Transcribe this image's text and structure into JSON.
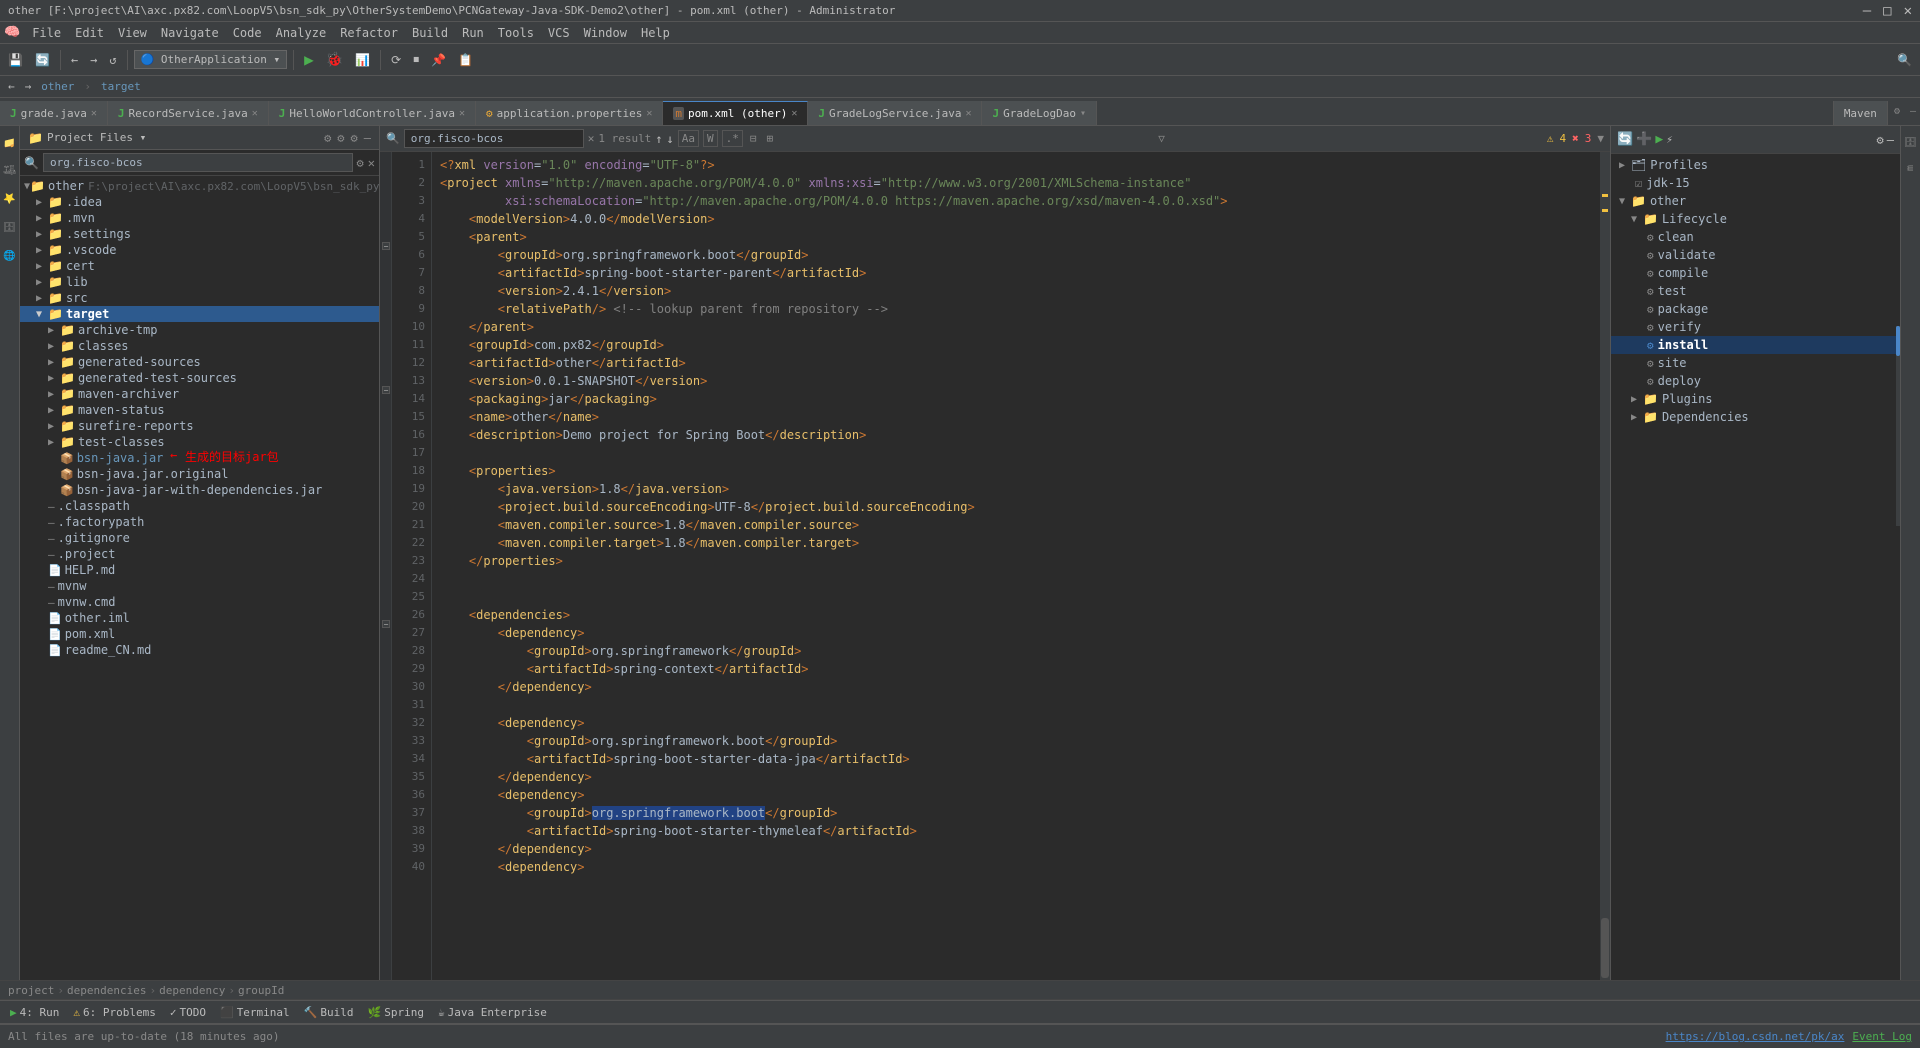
{
  "titleBar": {
    "text": "other [F:\\project\\AI\\axc.px82.com\\LoopV5\\bsn_sdk_py\\OtherSystemDemo\\PCNGateway-Java-SDK-Demo2\\other] - pom.xml (other) - Administrator",
    "minimize": "—",
    "maximize": "□",
    "close": "✕"
  },
  "menuBar": {
    "items": [
      "File",
      "Edit",
      "View",
      "Navigate",
      "Code",
      "Analyze",
      "Refactor",
      "Build",
      "Run",
      "Tools",
      "VCS",
      "Window",
      "Help"
    ]
  },
  "toolbar": {
    "projectDropdown": "OtherApplication",
    "runBtn": "▶",
    "debugBtn": "🐞",
    "profileBtn": "📊"
  },
  "navBar": {
    "backBtn": "←",
    "forwardBtn": "→",
    "path": "other > target"
  },
  "tabs": [
    {
      "label": "grade.java",
      "icon": "J",
      "active": false,
      "closable": true
    },
    {
      "label": "RecordService.java",
      "icon": "J",
      "active": false,
      "closable": true
    },
    {
      "label": "HelloWorldController.java",
      "icon": "J",
      "active": false,
      "closable": true
    },
    {
      "label": "application.properties",
      "icon": "⚙",
      "active": false,
      "closable": true
    },
    {
      "label": "pom.xml (other)",
      "icon": "m",
      "active": true,
      "closable": true
    },
    {
      "label": "GradeLogService.java",
      "icon": "J",
      "active": false,
      "closable": true
    },
    {
      "label": "GradeLogDao",
      "icon": "J",
      "active": false,
      "closable": false
    }
  ],
  "projectPanel": {
    "title": "Project Files",
    "root": "other",
    "rootPath": "F:\\project\\AI\\axc.px82.com\\LoopV5\\bsn_sdk_py\\OtherSyste..."
  },
  "projectTree": [
    {
      "id": "idea",
      "label": ".idea",
      "type": "folder",
      "indent": 1,
      "expanded": false
    },
    {
      "id": "mvn",
      "label": ".mvn",
      "type": "folder",
      "indent": 1,
      "expanded": false
    },
    {
      "id": "settings",
      "label": ".settings",
      "type": "folder",
      "indent": 1,
      "expanded": false
    },
    {
      "id": "vscode",
      "label": ".vscode",
      "type": "folder",
      "indent": 1,
      "expanded": false
    },
    {
      "id": "cert",
      "label": "cert",
      "type": "folder",
      "indent": 1,
      "expanded": false
    },
    {
      "id": "lib",
      "label": "lib",
      "type": "folder",
      "indent": 1,
      "expanded": false
    },
    {
      "id": "src",
      "label": "src",
      "type": "folder",
      "indent": 1,
      "expanded": false
    },
    {
      "id": "target",
      "label": "target",
      "type": "folder",
      "indent": 1,
      "expanded": true,
      "selected": true
    },
    {
      "id": "archive-tmp",
      "label": "archive-tmp",
      "type": "folder",
      "indent": 2,
      "expanded": false
    },
    {
      "id": "classes",
      "label": "classes",
      "type": "folder",
      "indent": 2,
      "expanded": false
    },
    {
      "id": "generated-sources",
      "label": "generated-sources",
      "type": "folder",
      "indent": 2,
      "expanded": false
    },
    {
      "id": "generated-test-sources",
      "label": "generated-test-sources",
      "type": "folder",
      "indent": 2,
      "expanded": false
    },
    {
      "id": "maven-archiver",
      "label": "maven-archiver",
      "type": "folder",
      "indent": 2,
      "expanded": false
    },
    {
      "id": "maven-status",
      "label": "maven-status",
      "type": "folder",
      "indent": 2,
      "expanded": false
    },
    {
      "id": "surefire-reports",
      "label": "surefire-reports",
      "type": "folder",
      "indent": 2,
      "expanded": false
    },
    {
      "id": "test-classes",
      "label": "test-classes",
      "type": "folder",
      "indent": 2,
      "expanded": false
    },
    {
      "id": "bsn-java-jar",
      "label": "bsn-java.jar",
      "type": "jar",
      "indent": 2,
      "expanded": false
    },
    {
      "id": "bsn-java-jar-original",
      "label": "bsn-java.jar.original",
      "type": "jar",
      "indent": 2,
      "expanded": false
    },
    {
      "id": "bsn-java-jar-deps",
      "label": "bsn-java-jar-with-dependencies.jar",
      "type": "jar",
      "indent": 2,
      "expanded": false
    },
    {
      "id": "classpath",
      "label": ".classpath",
      "type": "file",
      "indent": 1
    },
    {
      "id": "factorypath",
      "label": ".factorypath",
      "type": "file",
      "indent": 1
    },
    {
      "id": "gitignore",
      "label": ".gitignore",
      "type": "file",
      "indent": 1
    },
    {
      "id": "project-file",
      "label": ".project",
      "type": "file",
      "indent": 1
    },
    {
      "id": "help-md",
      "label": "HELP.md",
      "type": "md",
      "indent": 1
    },
    {
      "id": "mvnw",
      "label": "mvnw",
      "type": "file",
      "indent": 1
    },
    {
      "id": "mvnw-cmd",
      "label": "mvnw.cmd",
      "type": "file",
      "indent": 1
    },
    {
      "id": "other-iml",
      "label": "other.iml",
      "type": "iml",
      "indent": 1
    },
    {
      "id": "pom-xml",
      "label": "pom.xml",
      "type": "xml",
      "indent": 1
    },
    {
      "id": "readme-cn",
      "label": "readme_CN.md",
      "type": "md",
      "indent": 1
    }
  ],
  "searchBar": {
    "placeholder": "org.fisco-bcos",
    "value": "org.fisco-bcos",
    "resultCount": "1 result"
  },
  "editorSearch": {
    "placeholder": "org.fisco-bcos",
    "value": "org.fisco-bcos",
    "resultCount": "1 result",
    "matchCase": "Aa",
    "wholeWord": "W",
    "regex": ".*"
  },
  "warnings": {
    "warningCount": "4",
    "errorCount": "3"
  },
  "codeLines": [
    {
      "num": "1",
      "content": "<?xml version=\"1.0\" encoding=\"UTF-8\"?>"
    },
    {
      "num": "2",
      "content": "<project xmlns=\"http://maven.apache.org/POM/4.0.0\" xmlns:xsi=\"http://www.w3.org/2001/XMLSchema-instance\""
    },
    {
      "num": "3",
      "content": "         xsi:schemaLocation=\"http://maven.apache.org/POM/4.0.0 https://maven.apache.org/xsd/maven-4.0.0.xsd\">"
    },
    {
      "num": "4",
      "content": "    <modelVersion>4.0.0</modelVersion>"
    },
    {
      "num": "5",
      "content": "    <parent>"
    },
    {
      "num": "6",
      "content": "        <groupId>org.springframework.boot</groupId>"
    },
    {
      "num": "7",
      "content": "        <artifactId>spring-boot-starter-parent</artifactId>"
    },
    {
      "num": "8",
      "content": "        <version>2.4.1</version>"
    },
    {
      "num": "9",
      "content": "        <relativePath/> <!-- lookup parent from repository -->"
    },
    {
      "num": "10",
      "content": "    </parent>"
    },
    {
      "num": "11",
      "content": "    <groupId>com.px82</groupId>"
    },
    {
      "num": "12",
      "content": "    <artifactId>other</artifactId>"
    },
    {
      "num": "13",
      "content": "    <version>0.0.1-SNAPSHOT</version>"
    },
    {
      "num": "14",
      "content": "    <packaging>jar</packaging>"
    },
    {
      "num": "15",
      "content": "    <name>other</name>"
    },
    {
      "num": "16",
      "content": "    <description>Demo project for Spring Boot</description>"
    },
    {
      "num": "17",
      "content": ""
    },
    {
      "num": "18",
      "content": "    <properties>"
    },
    {
      "num": "19",
      "content": "        <java.version>1.8</java.version>"
    },
    {
      "num": "20",
      "content": "        <project.build.sourceEncoding>UTF-8</project.build.sourceEncoding>"
    },
    {
      "num": "21",
      "content": "        <maven.compiler.source>1.8</maven.compiler.source>"
    },
    {
      "num": "22",
      "content": "        <maven.compiler.target>1.8</maven.compiler.target>"
    },
    {
      "num": "23",
      "content": "    </properties>"
    },
    {
      "num": "24",
      "content": ""
    },
    {
      "num": "25",
      "content": ""
    },
    {
      "num": "26",
      "content": "    <dependencies>"
    },
    {
      "num": "27",
      "content": "        <dependency>"
    },
    {
      "num": "28",
      "content": "            <groupId>org.springframework</groupId>"
    },
    {
      "num": "29",
      "content": "            <artifactId>spring-context</artifactId>"
    },
    {
      "num": "30",
      "content": "        </dependency>"
    },
    {
      "num": "31",
      "content": ""
    },
    {
      "num": "32",
      "content": "        <dependency>"
    },
    {
      "num": "33",
      "content": "            <groupId>org.springframework.boot</groupId>"
    },
    {
      "num": "34",
      "content": "            <artifactId>spring-boot-starter-data-jpa</artifactId>"
    },
    {
      "num": "35",
      "content": "        </dependency>"
    },
    {
      "num": "36",
      "content": "        <dependency>"
    },
    {
      "num": "37",
      "content": "            <groupId>org.springframework.boot</groupId>"
    },
    {
      "num": "38",
      "content": "            <artifactId>spring-boot-starter-thymeleaf</artifactId>"
    },
    {
      "num": "39",
      "content": "        </dependency>"
    },
    {
      "num": "40",
      "content": "        <dependency>"
    }
  ],
  "breadcrumb": {
    "items": [
      "project",
      "dependencies",
      "dependency",
      "groupId"
    ]
  },
  "mavenPanel": {
    "title": "Maven",
    "profiles": "Profiles",
    "jdk": "jdk-15",
    "projectName": "other",
    "lifecycle": "Lifecycle",
    "lifecycleItems": [
      "clean",
      "validate",
      "compile",
      "test",
      "package",
      "verify",
      "install",
      "site",
      "deploy"
    ],
    "activeItem": "install",
    "plugins": "Plugins",
    "dependencies": "Dependencies"
  },
  "bottomTabs": [
    {
      "label": "Run",
      "icon": "▶",
      "badge": "4"
    },
    {
      "label": "Problems",
      "icon": "⚠",
      "badge": "6"
    },
    {
      "label": "TODO",
      "icon": "✓",
      "badge": ""
    },
    {
      "label": "Terminal",
      "icon": "◻",
      "badge": ""
    },
    {
      "label": "Build",
      "icon": "🔨",
      "badge": ""
    },
    {
      "label": "Spring",
      "icon": "🌿",
      "badge": ""
    },
    {
      "label": "Java Enterprise",
      "icon": "☕",
      "badge": ""
    }
  ],
  "statusBar": {
    "leftText": "All files are up-to-date (18 minutes ago)",
    "rightLink": "https://blog.csdn.net/pk/ax",
    "eventLog": "Event Log"
  },
  "annotation": {
    "text": "生成的目标jar包",
    "arrowText": "←"
  }
}
